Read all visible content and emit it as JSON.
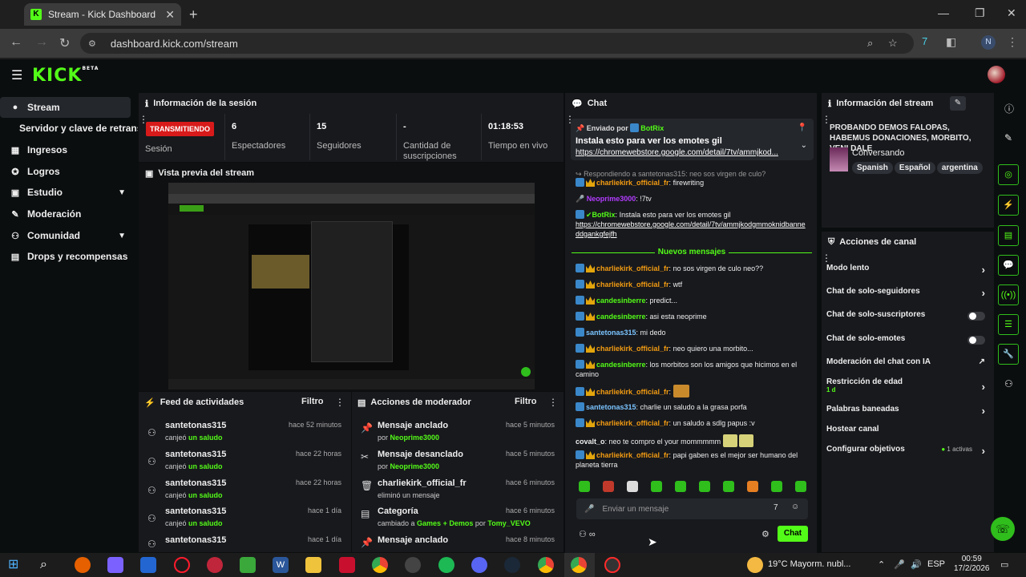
{
  "browser": {
    "tab_title": "Stream - Kick Dashboard",
    "tab_favicon": "K",
    "url": "dashboard.kick.com/stream",
    "profile_initial": "N"
  },
  "header": {
    "logo": "KICK",
    "beta": "BETA"
  },
  "sidebar": {
    "items": [
      {
        "label": "Stream",
        "icon": "●"
      },
      {
        "label": "Servidor y clave de retransmisión",
        "icon": ""
      },
      {
        "label": "Ingresos",
        "icon": "▦"
      },
      {
        "label": "Logros",
        "icon": "✪"
      },
      {
        "label": "Estudio",
        "icon": "▣"
      },
      {
        "label": "Moderación",
        "icon": "✎"
      },
      {
        "label": "Comunidad",
        "icon": "⚇"
      },
      {
        "label": "Drops y recompensas",
        "icon": "▤"
      }
    ]
  },
  "session": {
    "title": "Información de la sesión",
    "live_badge": "TRANSMITIENDO",
    "session_label": "Sesión",
    "stats": [
      {
        "value": "6",
        "label": "Espectadores"
      },
      {
        "value": "15",
        "label": "Seguidores"
      },
      {
        "value": "-",
        "label": "Cantidad de suscripciones"
      },
      {
        "value": "01:18:53",
        "label": "Tiempo en vivo"
      }
    ]
  },
  "preview": {
    "title": "Vista previa del stream"
  },
  "feed": {
    "title": "Feed de actividades",
    "filter": "Filtro",
    "items": [
      {
        "user": "santetonas315",
        "time": "hace 52 minutos",
        "pre": "canjeó",
        "what": "un saludo"
      },
      {
        "user": "santetonas315",
        "time": "hace 22 horas",
        "pre": "canjeó",
        "what": "un saludo"
      },
      {
        "user": "santetonas315",
        "time": "hace 22 horas",
        "pre": "canjeó",
        "what": "un saludo"
      },
      {
        "user": "santetonas315",
        "time": "hace 1 día",
        "pre": "canjeó",
        "what": "un saludo"
      },
      {
        "user": "santetonas315",
        "time": "hace 1 día",
        "pre": "",
        "what": ""
      }
    ]
  },
  "mod_actions": {
    "title": "Acciones de moderador",
    "filter": "Filtro",
    "items": [
      {
        "icon": "📌",
        "title": "Mensaje anclado",
        "time": "hace 5 minutos",
        "pre": "por",
        "who": "Neoprime3000",
        "mid": "",
        "who2": ""
      },
      {
        "icon": "✂",
        "title": "Mensaje desanclado",
        "time": "hace 5 minutos",
        "pre": "por",
        "who": "Neoprime3000",
        "mid": "",
        "who2": ""
      },
      {
        "icon": "🗑",
        "title": "charliekirk_official_fr",
        "time": "hace 6 minutos",
        "pre": "eliminó un mensaje",
        "who": "",
        "mid": "",
        "who2": ""
      },
      {
        "icon": "▤",
        "title": "Categoría",
        "time": "hace 6 minutos",
        "pre": "cambiado a",
        "who": "Games + Demos",
        "mid": "por",
        "who2": "Tomy_VEVO"
      },
      {
        "icon": "📌",
        "title": "Mensaje anclado",
        "time": "hace 8 minutos",
        "pre": "",
        "who": "",
        "mid": "",
        "who2": ""
      }
    ]
  },
  "chat": {
    "title": "Chat",
    "pinned": {
      "by_label": "Enviado por",
      "by_user": "BotRix",
      "text": "Instala esto para ver los emotes gil",
      "link": "https://chromewebstore.google.com/detail/7tv/ammjkod..."
    },
    "reply_to": "Respondiendo a santetonas315: neo sos virgen de culo?",
    "messages_before": [
      {
        "user": "charliekirk_official_fr",
        "color": "u-o",
        "text": "firewriting",
        "badges": [
          "badge",
          "crown"
        ]
      },
      {
        "user": "Neoprime3000",
        "color": "u-p",
        "text": "!7tv",
        "badges": [
          "mic"
        ]
      },
      {
        "user": "BotRix",
        "color": "u-g",
        "text": "Instala esto para ver los emotes gil",
        "link": "https://chromewebstore.google.com/detail/7tv/ammjkodgmmoknidbanneddgankgfejfh",
        "badges": [
          "badge",
          "check"
        ]
      }
    ],
    "new_label": "Nuevos mensajes",
    "messages": [
      {
        "user": "charliekirk_official_fr",
        "color": "u-o",
        "text": "no sos virgen de culo neo??",
        "badges": [
          "badge",
          "crown"
        ]
      },
      {
        "user": "charliekirk_official_fr",
        "color": "u-o",
        "text": "wtf",
        "badges": [
          "badge",
          "crown"
        ]
      },
      {
        "user": "candesinberre",
        "color": "u-g",
        "text": "predict...",
        "badges": [
          "badge",
          "crown"
        ]
      },
      {
        "user": "candesinberre",
        "color": "u-g",
        "text": "asi esta neoprime",
        "badges": [
          "badge",
          "crown"
        ]
      },
      {
        "user": "santetonas315",
        "color": "u-b",
        "text": "mi dedo",
        "badges": [
          "badge"
        ]
      },
      {
        "user": "charliekirk_official_fr",
        "color": "u-o",
        "text": "neo quiero una morbito...",
        "badges": [
          "badge",
          "crown"
        ]
      },
      {
        "user": "candesinberre",
        "color": "u-g",
        "text": "los morbitos son los amigos que hicimos en el camino",
        "badges": [
          "badge",
          "crown"
        ]
      },
      {
        "user": "charliekirk_official_fr",
        "color": "u-o",
        "text": "",
        "badges": [
          "badge",
          "crown"
        ]
      },
      {
        "user": "santetonas315",
        "color": "u-b",
        "text": "charlie un saludo a la grasa porfa",
        "badges": [
          "badge"
        ]
      },
      {
        "user": "charliekirk_official_fr",
        "color": "u-o",
        "text": "un saludo a sdlg papus :v",
        "badges": [
          "badge",
          "crown"
        ]
      },
      {
        "user": "covalt_o",
        "color": "u-w",
        "text": "neo te compro el your mommmmm",
        "badges": []
      },
      {
        "user": "charliekirk_official_fr",
        "color": "u-o",
        "text": "papi gaben es el mejor ser humano del planeta tierra",
        "badges": [
          "badge",
          "crown"
        ]
      }
    ],
    "input_placeholder": "Enviar un mensaje",
    "send_label": "Chat",
    "infinity": "∞"
  },
  "stream_info": {
    "title": "Información del stream",
    "stream_title": "PROBANDO DEMOS FALOPAS, HABEMUS DONACIONES, MORBITO, VENI DALE",
    "category": "Conversando",
    "tags": [
      "Spanish",
      "Español",
      "argentina"
    ]
  },
  "channel_actions": {
    "title": "Acciones de canal",
    "rows": [
      {
        "label": "Modo lento",
        "control": "chevron",
        "sub": "",
        "extra": ""
      },
      {
        "label": "Chat de solo-seguidores",
        "control": "chevron",
        "sub": "",
        "extra": ""
      },
      {
        "label": "Chat de solo-suscriptores",
        "control": "toggle",
        "sub": "",
        "extra": ""
      },
      {
        "label": "Chat de solo-emotes",
        "control": "toggle",
        "sub": "",
        "extra": ""
      },
      {
        "label": "Moderación del chat con IA",
        "control": "external",
        "sub": "",
        "extra": ""
      },
      {
        "label": "Restricción de edad",
        "control": "chevron",
        "sub": "1 d",
        "extra": ""
      },
      {
        "label": "Palabras baneadas",
        "control": "chevron",
        "sub": "",
        "extra": ""
      },
      {
        "label": "Hostear canal",
        "control": "none",
        "sub": "",
        "extra": ""
      },
      {
        "label": "Configurar objetivos",
        "control": "chevron",
        "sub": "",
        "extra": "1 activas"
      }
    ]
  },
  "taskbar": {
    "weather": "19°C  Mayorm. nubl...",
    "lang": "ESP",
    "time": "00:59",
    "date": "17/2/2026"
  },
  "colors": {
    "accent": "#53fc18",
    "live": "#d81a1a",
    "panel": "#18191d",
    "bg": "#0b0e0f"
  }
}
